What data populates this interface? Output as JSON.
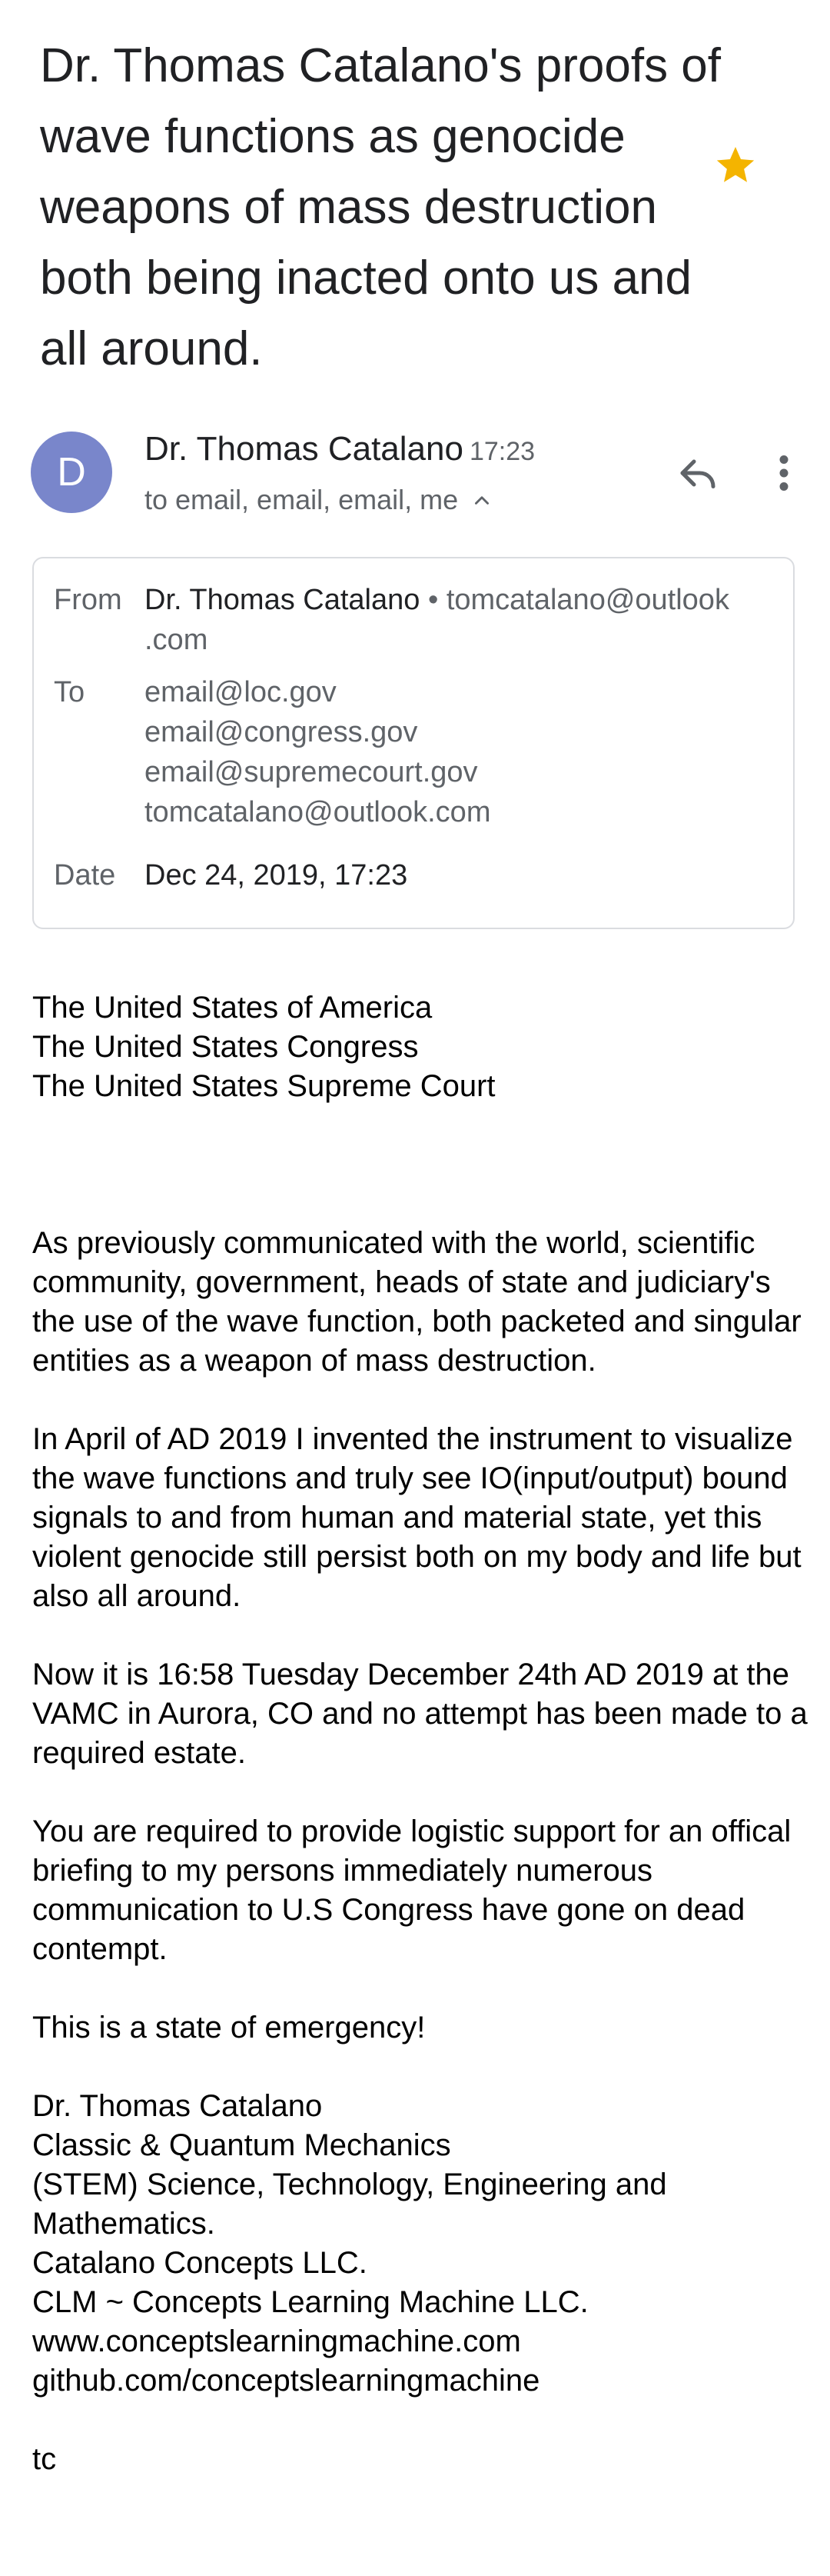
{
  "email": {
    "subject": "Dr. Thomas Catalano's proofs of wave functions as genocide weapons of mass destruction both being inacted onto us and all around.",
    "sender": {
      "initial": "D",
      "name": "Dr. Thomas Catalano",
      "time": "17:23",
      "recipients_summary": "to email, email, email, me"
    },
    "details": {
      "from_label": "From",
      "from_name": "Dr. Thomas Catalano",
      "from_sep": "•",
      "from_email_1": "tomcatalano@outlook",
      "from_email_2": ".com",
      "to_label": "To",
      "to": [
        "email@loc.gov",
        "email@congress.gov",
        "email@supremecourt.gov",
        "tomcatalano@outlook.com"
      ],
      "date_label": "Date",
      "date": "Dec 24, 2019, 17:23"
    },
    "body": {
      "addressees": [
        "The United States of America",
        "The United States Congress",
        "The United States Supreme Court"
      ],
      "paragraphs": [
        "As previously communicated with the world, scientific community, government, heads of state and judiciary's the use of the wave function, both packeted and singular entities as a weapon of mass destruction.",
        "In April of AD 2019 I invented the instrument to visualize the wave functions and truly see IO(input/output) bound signals to and from human and material state, yet this violent genocide still persist both on my body and life but also all around.",
        "Now it is 16:58 Tuesday December 24th AD 2019 at the VAMC in Aurora, CO and no attempt has been made to a required estate.",
        "You are required to provide logistic support for an offical briefing to my persons immediately numerous communication to U.S Congress have gone on dead contempt.",
        "This is a state of emergency!"
      ],
      "signature": [
        "Dr. Thomas Catalano",
        "Classic & Quantum Mechanics",
        "(STEM) Science, Technology, Engineering and Mathematics.",
        "Catalano Concepts LLC.",
        "CLM ~ Concepts Learning Machine LLC.",
        "www.conceptslearningmachine.com",
        "github.com/conceptslearningmachine"
      ],
      "closing": "tc"
    }
  },
  "colors": {
    "avatar": "#7986cb",
    "star": "#f4b400",
    "secondary_text": "#5f6368",
    "primary_text": "#202124",
    "border": "#dadce0"
  },
  "icons": [
    "star-icon",
    "reply-icon",
    "more-vert-icon",
    "chevron-up-icon"
  ]
}
